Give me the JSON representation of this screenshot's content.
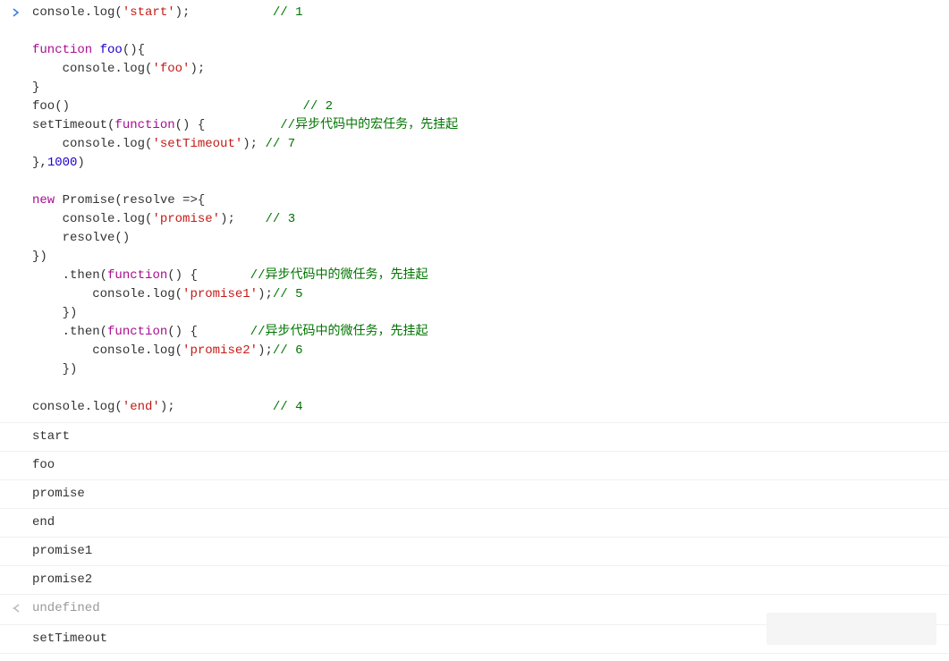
{
  "code": {
    "l1": {
      "a": "console.log(",
      "s": "'start'",
      "b": ");",
      "pad": "           ",
      "c": "// 1"
    },
    "l2": {
      "blank": " "
    },
    "l3": {
      "kw": "function",
      "sp": " ",
      "fn": "foo",
      "rest": "(){"
    },
    "l4": {
      "indent": "    ",
      "a": "console.log(",
      "s": "'foo'",
      "b": ");"
    },
    "l5": {
      "a": "}"
    },
    "l6": {
      "a": "foo()",
      "pad": "                               ",
      "c": "// 2"
    },
    "l7": {
      "a": "setTimeout(",
      "kw": "function",
      "b": "() {",
      "pad": "          ",
      "c": "//异步代码中的宏任务，先挂起"
    },
    "l8": {
      "indent": "    ",
      "a": "console.log(",
      "s": "'setTimeout'",
      "b": "); ",
      "c": "// 7"
    },
    "l9": {
      "a": "},",
      "n": "1000",
      "b": ")"
    },
    "l10": {
      "blank": " "
    },
    "l11": {
      "kw": "new",
      "sp": " ",
      "a": "Promise(resolve =>{"
    },
    "l12": {
      "indent": "    ",
      "a": "console.log(",
      "s": "'promise'",
      "b": ");",
      "pad": "    ",
      "c": "// 3"
    },
    "l13": {
      "indent": "    ",
      "a": "resolve()"
    },
    "l14": {
      "a": "})"
    },
    "l15": {
      "indent": "    ",
      "a": ".then(",
      "kw": "function",
      "b": "() {",
      "pad": "       ",
      "c": "//异步代码中的微任务，先挂起"
    },
    "l16": {
      "indent": "        ",
      "a": "console.log(",
      "s": "'promise1'",
      "b": ");",
      "c": "// 5"
    },
    "l17": {
      "indent": "    ",
      "a": "})"
    },
    "l18": {
      "indent": "    ",
      "a": ".then(",
      "kw": "function",
      "b": "() {",
      "pad": "       ",
      "c": "//异步代码中的微任务，先挂起"
    },
    "l19": {
      "indent": "        ",
      "a": "console.log(",
      "s": "'promise2'",
      "b": ");",
      "c": "// 6"
    },
    "l20": {
      "indent": "    ",
      "a": "})"
    },
    "l21": {
      "blank": " "
    },
    "l22": {
      "a": "console.log(",
      "s": "'end'",
      "b": ");",
      "pad": "             ",
      "c": "// 4"
    }
  },
  "output": {
    "o1": "start",
    "o2": "foo",
    "o3": "promise",
    "o4": "end",
    "o5": "promise1",
    "o6": "promise2",
    "ret": "undefined",
    "o7": "setTimeout"
  }
}
